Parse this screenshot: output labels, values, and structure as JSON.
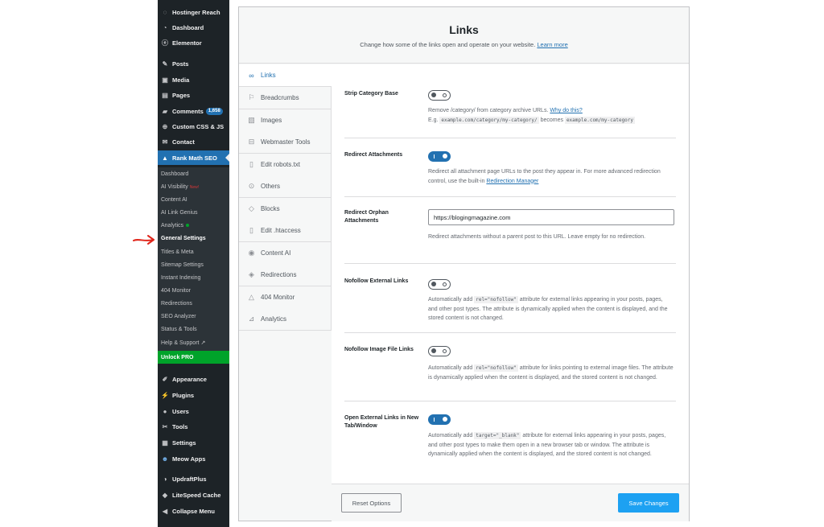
{
  "sidebar": {
    "top_items": [
      {
        "label": "Hostinger Reach",
        "icon": "hostinger-icon"
      },
      {
        "label": "Dashboard",
        "icon": "dashboard-icon"
      },
      {
        "label": "Elementor",
        "icon": "elementor-icon"
      },
      {
        "label": "Posts",
        "icon": "pin-icon"
      },
      {
        "label": "Media",
        "icon": "media-icon"
      },
      {
        "label": "Pages",
        "icon": "pages-icon"
      },
      {
        "label": "Comments",
        "icon": "comments-icon",
        "badge": "1,658"
      },
      {
        "label": "Custom CSS & JS",
        "icon": "plus-circle-icon"
      },
      {
        "label": "Contact",
        "icon": "mail-icon"
      },
      {
        "label": "Rank Math SEO",
        "icon": "rank-math-icon",
        "active": true
      }
    ],
    "submenu": [
      {
        "label": "Dashboard"
      },
      {
        "label": "AI Visibility",
        "tag": "New!"
      },
      {
        "label": "Content AI"
      },
      {
        "label": "AI Link Genius"
      },
      {
        "label": "Analytics",
        "dot": true
      },
      {
        "label": "General Settings",
        "current": true
      },
      {
        "label": "Titles & Meta"
      },
      {
        "label": "Sitemap Settings"
      },
      {
        "label": "Instant Indexing"
      },
      {
        "label": "404 Monitor"
      },
      {
        "label": "Redirections"
      },
      {
        "label": "SEO Analyzer"
      },
      {
        "label": "Status & Tools"
      },
      {
        "label": "Help & Support",
        "ext": "↗"
      }
    ],
    "unlock_label": "Unlock PRO",
    "bottom_items": [
      {
        "label": "Appearance",
        "icon": "brush-icon"
      },
      {
        "label": "Plugins",
        "icon": "plug-icon"
      },
      {
        "label": "Users",
        "icon": "user-icon"
      },
      {
        "label": "Tools",
        "icon": "wrench-icon"
      },
      {
        "label": "Settings",
        "icon": "settings-icon"
      },
      {
        "label": "Meow Apps",
        "icon": "meow-icon"
      },
      {
        "label": "UpdraftPlus",
        "icon": "updraft-icon"
      },
      {
        "label": "LiteSpeed Cache",
        "icon": "litespeed-icon"
      },
      {
        "label": "Collapse Menu",
        "icon": "collapse-icon"
      }
    ]
  },
  "header": {
    "title": "Links",
    "description": "Change how some of the links open and operate on your website.",
    "learn_more": "Learn more"
  },
  "tabs": [
    {
      "label": "Links",
      "icon": "link-icon",
      "active": true
    },
    {
      "label": "Breadcrumbs",
      "icon": "signpost-icon"
    },
    {
      "label": "Images",
      "icon": "images-icon"
    },
    {
      "label": "Webmaster Tools",
      "icon": "toolbox-icon"
    },
    {
      "label": "Edit robots.txt",
      "icon": "file-icon"
    },
    {
      "label": "Others",
      "icon": "circle-dots-icon"
    },
    {
      "label": "Blocks",
      "icon": "blocks-icon"
    },
    {
      "label": "Edit .htaccess",
      "icon": "file-icon"
    },
    {
      "label": "Content AI",
      "icon": "content-ai-icon"
    },
    {
      "label": "Redirections",
      "icon": "redirect-icon"
    },
    {
      "label": "404 Monitor",
      "icon": "warning-icon"
    },
    {
      "label": "Analytics",
      "icon": "chart-icon"
    }
  ],
  "settings": {
    "strip_category": {
      "label": "Strip Category Base",
      "toggle": "off",
      "desc_pre": "Remove /category/ from category archive URLs.",
      "desc_link": "Why do this?",
      "eg": "E.g.",
      "code1": "example.com/category/my-category/",
      "becomes": "becomes",
      "code2": "example.com/my-category"
    },
    "redirect_attachments": {
      "label": "Redirect Attachments",
      "toggle": "on",
      "desc_pre": "Redirect all attachment page URLs to the post they appear in. For more advanced redirection control, use the built-in",
      "desc_link": "Redirection Manager"
    },
    "redirect_orphan": {
      "label": "Redirect Orphan Attachments",
      "value": "https://blogingmagazine.com",
      "desc": "Redirect attachments without a parent post to this URL. Leave empty for no redirection."
    },
    "nofollow_external": {
      "label": "Nofollow External Links",
      "toggle": "off",
      "desc_pre": "Automatically add",
      "code": "rel=\"nofollow\"",
      "desc_post": "attribute for external links appearing in your posts, pages, and other post types. The attribute is dynamically applied when the content is displayed, and the stored content is not changed."
    },
    "nofollow_image": {
      "label": "Nofollow Image File Links",
      "toggle": "off",
      "desc_pre": "Automatically add",
      "code": "rel=\"nofollow\"",
      "desc_post": "attribute for links pointing to external image files. The attribute is dynamically applied when the content is displayed, and the stored content is not changed."
    },
    "open_external": {
      "label": "Open External Links in New Tab/Window",
      "toggle": "on",
      "desc_pre": "Automatically add",
      "code": "target=\"_blank\"",
      "desc_post": "attribute for external links appearing in your posts, pages, and other post types to make them open in a new browser tab or window. The attribute is dynamically applied when the content is displayed, and the stored content is not changed."
    }
  },
  "footer": {
    "reset_label": "Reset Options",
    "save_label": "Save Changes"
  },
  "colors": {
    "sidebar_bg": "#1d2327",
    "accent": "#2271b1",
    "save_button": "#1da1f2",
    "unlock_green": "#00a32a",
    "arrow_red": "#e0261b"
  }
}
